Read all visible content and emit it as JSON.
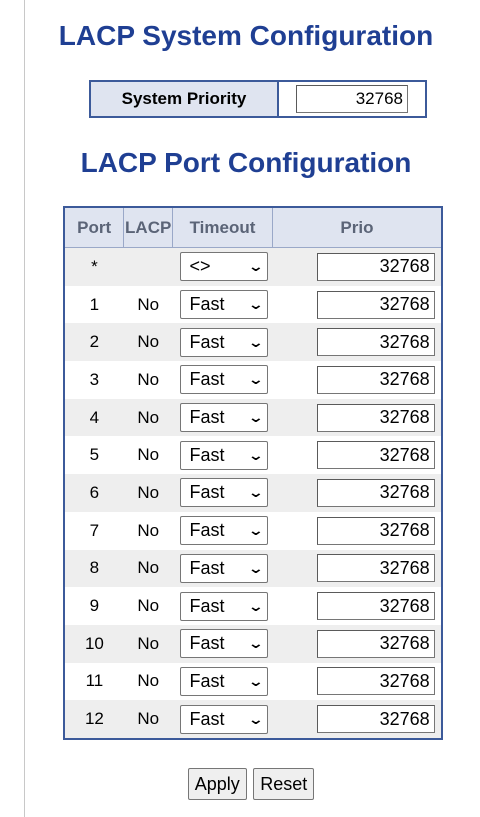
{
  "system": {
    "title": "LACP System Configuration",
    "priority_label": "System Priority",
    "priority_value": "32768"
  },
  "ports": {
    "title": "LACP Port Configuration",
    "headers": {
      "port": "Port",
      "lacp": "LACP",
      "timeout": "Timeout",
      "prio": "Prio"
    },
    "wildcard": {
      "port": "*",
      "lacp": "",
      "timeout": "<>",
      "prio": "32768"
    },
    "rows": [
      {
        "port": "1",
        "lacp": "No",
        "timeout": "Fast",
        "prio": "32768"
      },
      {
        "port": "2",
        "lacp": "No",
        "timeout": "Fast",
        "prio": "32768"
      },
      {
        "port": "3",
        "lacp": "No",
        "timeout": "Fast",
        "prio": "32768"
      },
      {
        "port": "4",
        "lacp": "No",
        "timeout": "Fast",
        "prio": "32768"
      },
      {
        "port": "5",
        "lacp": "No",
        "timeout": "Fast",
        "prio": "32768"
      },
      {
        "port": "6",
        "lacp": "No",
        "timeout": "Fast",
        "prio": "32768"
      },
      {
        "port": "7",
        "lacp": "No",
        "timeout": "Fast",
        "prio": "32768"
      },
      {
        "port": "8",
        "lacp": "No",
        "timeout": "Fast",
        "prio": "32768"
      },
      {
        "port": "9",
        "lacp": "No",
        "timeout": "Fast",
        "prio": "32768"
      },
      {
        "port": "10",
        "lacp": "No",
        "timeout": "Fast",
        "prio": "32768"
      },
      {
        "port": "11",
        "lacp": "No",
        "timeout": "Fast",
        "prio": "32768"
      },
      {
        "port": "12",
        "lacp": "No",
        "timeout": "Fast",
        "prio": "32768"
      }
    ]
  },
  "buttons": {
    "apply": "Apply",
    "reset": "Reset"
  },
  "icons": {
    "dropdown": "chevron-down-icon"
  },
  "colors": {
    "heading": "#1f3f93",
    "table_border": "#3c5a9a",
    "header_bg": "#dfe4f0",
    "alt_row": "#eeeeee"
  }
}
